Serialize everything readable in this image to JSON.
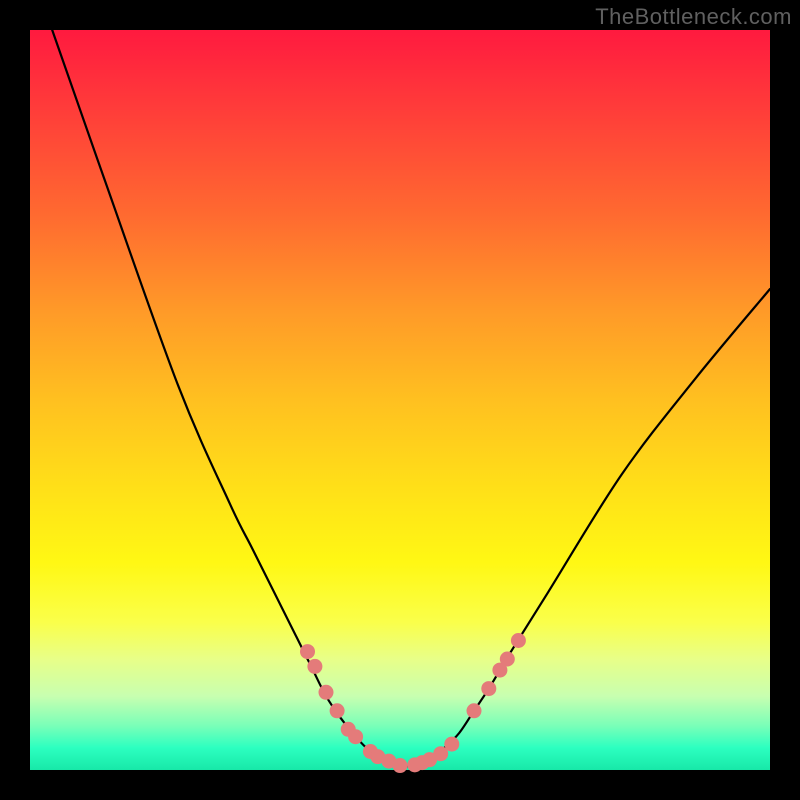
{
  "watermark": "TheBottleneck.com",
  "chart_data": {
    "type": "line",
    "title": "",
    "xlabel": "",
    "ylabel": "",
    "xlim": [
      0,
      100
    ],
    "ylim": [
      0,
      100
    ],
    "series": [
      {
        "name": "bottleneck-curve",
        "x": [
          3,
          10,
          20,
          27,
          30,
          33,
          36,
          38,
          40,
          42,
          44,
          46,
          48,
          50,
          52,
          54,
          56,
          58,
          60,
          62,
          65,
          70,
          80,
          90,
          100
        ],
        "y": [
          100,
          80,
          52,
          36,
          30,
          24,
          18,
          14,
          10,
          7,
          4.5,
          2.5,
          1.2,
          0.5,
          0.7,
          1.5,
          3,
          5,
          8,
          11,
          16,
          24,
          40,
          53,
          65
        ]
      }
    ],
    "markers": {
      "name": "highlight-points",
      "color": "#e47b7a",
      "x": [
        37.5,
        38.5,
        40,
        41.5,
        43,
        44,
        46,
        47,
        48.5,
        50,
        52,
        53,
        54,
        55.5,
        57,
        60,
        62,
        63.5,
        64.5,
        66
      ],
      "y": [
        16,
        14,
        10.5,
        8,
        5.5,
        4.5,
        2.5,
        1.8,
        1.2,
        0.6,
        0.7,
        1,
        1.4,
        2.2,
        3.5,
        8,
        11,
        13.5,
        15,
        17.5
      ]
    }
  }
}
